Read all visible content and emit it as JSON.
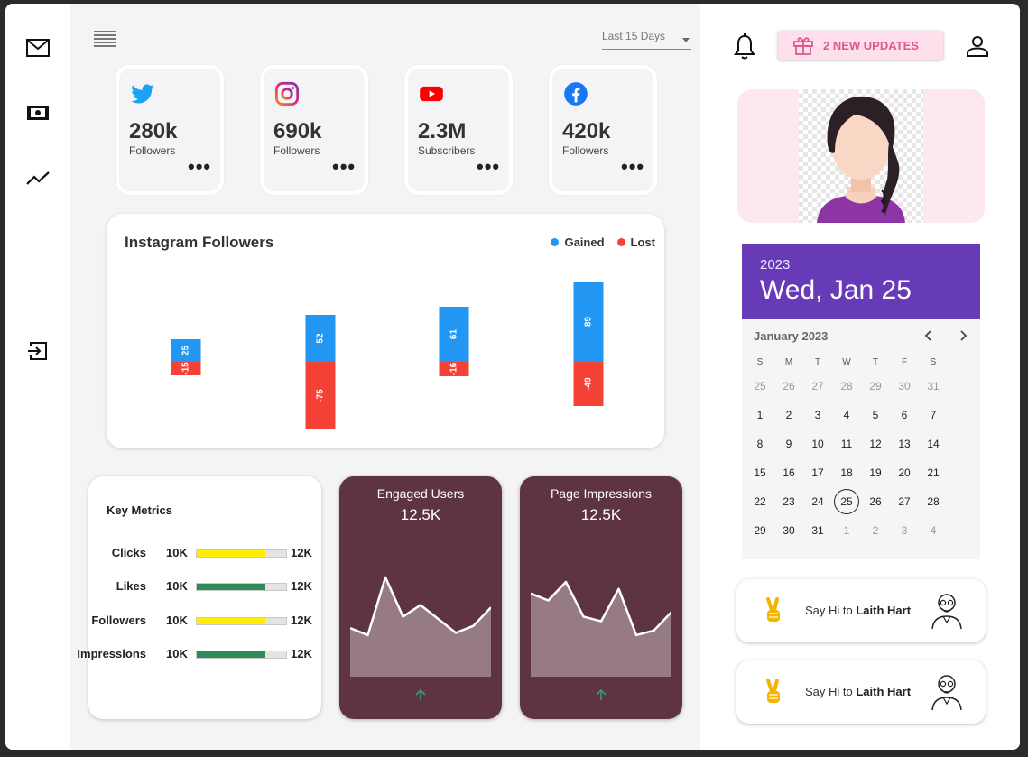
{
  "sidebar": {
    "items": [
      {
        "icon": "mail-icon"
      },
      {
        "icon": "money-icon"
      },
      {
        "icon": "trending-icon"
      },
      {
        "icon": "logout-icon"
      }
    ]
  },
  "toolbar": {
    "menu_icon": "menu-icon",
    "range_value": "Last 15 Days"
  },
  "social": [
    {
      "icon": "twitter-icon",
      "value": "280k",
      "label": "Followers",
      "color": "#1DA1F2"
    },
    {
      "icon": "instagram-icon",
      "value": "690k",
      "label": "Followers",
      "color": "#E1306C"
    },
    {
      "icon": "youtube-icon",
      "value": "2.3M",
      "label": "Subscribers",
      "color": "#FF0000"
    },
    {
      "icon": "facebook-icon",
      "value": "420k",
      "label": "Followers",
      "color": "#1877F2"
    }
  ],
  "more_label": "•••",
  "chart_data": {
    "type": "bar",
    "title": "Instagram Followers",
    "legend": [
      "Gained",
      "Lost"
    ],
    "legend_placement": "top-right",
    "categories": [
      "",
      "",
      "",
      ""
    ],
    "series": [
      {
        "name": "Gained",
        "values": [
          25,
          52,
          61,
          89
        ],
        "color": "#2196f3"
      },
      {
        "name": "Lost",
        "values": [
          -15,
          -75,
          -16,
          -49
        ],
        "color": "#f44336"
      }
    ],
    "stacked": true,
    "grid": false
  },
  "metrics": {
    "title": "Key Metrics",
    "rows": [
      {
        "name": "Clicks",
        "min": "10K",
        "max": "12K",
        "fraction": 0.77,
        "color": "#ffee00"
      },
      {
        "name": "Likes",
        "min": "10K",
        "max": "12K",
        "fraction": 0.77,
        "color": "#2e8b57"
      },
      {
        "name": "Followers",
        "min": "10K",
        "max": "12K",
        "fraction": 0.77,
        "color": "#ffee00"
      },
      {
        "name": "Impressions",
        "min": "10K",
        "max": "12K",
        "fraction": 0.77,
        "color": "#2e8b57"
      }
    ]
  },
  "trends": [
    {
      "title": "Engaged Users",
      "value": "12.5K",
      "series": [
        42,
        36,
        86,
        52,
        62,
        50,
        38,
        44,
        60
      ]
    },
    {
      "title": "Page Impressions",
      "value": "12.5K",
      "series": [
        72,
        66,
        82,
        52,
        48,
        76,
        36,
        40,
        56
      ]
    }
  ],
  "header": {
    "bell_icon": "bell-icon",
    "updates_label": "2 NEW UPDATES",
    "gift_icon": "gift-icon",
    "user_icon": "user-icon"
  },
  "calendar": {
    "year": "2023",
    "date_label": "Wed, Jan 25",
    "month_label": "January 2023",
    "weekdays": [
      "S",
      "M",
      "T",
      "W",
      "T",
      "F",
      "S"
    ],
    "weeks": [
      [
        "25",
        "26",
        "27",
        "28",
        "29",
        "30",
        "31"
      ],
      [
        "1",
        "2",
        "3",
        "4",
        "5",
        "6",
        "7"
      ],
      [
        "8",
        "9",
        "10",
        "11",
        "12",
        "13",
        "14"
      ],
      [
        "15",
        "16",
        "17",
        "18",
        "19",
        "20",
        "21"
      ],
      [
        "22",
        "23",
        "24",
        "25",
        "26",
        "27",
        "28"
      ],
      [
        "29",
        "30",
        "31",
        "1",
        "2",
        "3",
        "4"
      ]
    ],
    "selected": "25"
  },
  "greetings": [
    {
      "prefix": "Say Hi to ",
      "name": "Laith Hart"
    },
    {
      "prefix": "Say Hi to ",
      "name": "Laith Hart"
    }
  ]
}
